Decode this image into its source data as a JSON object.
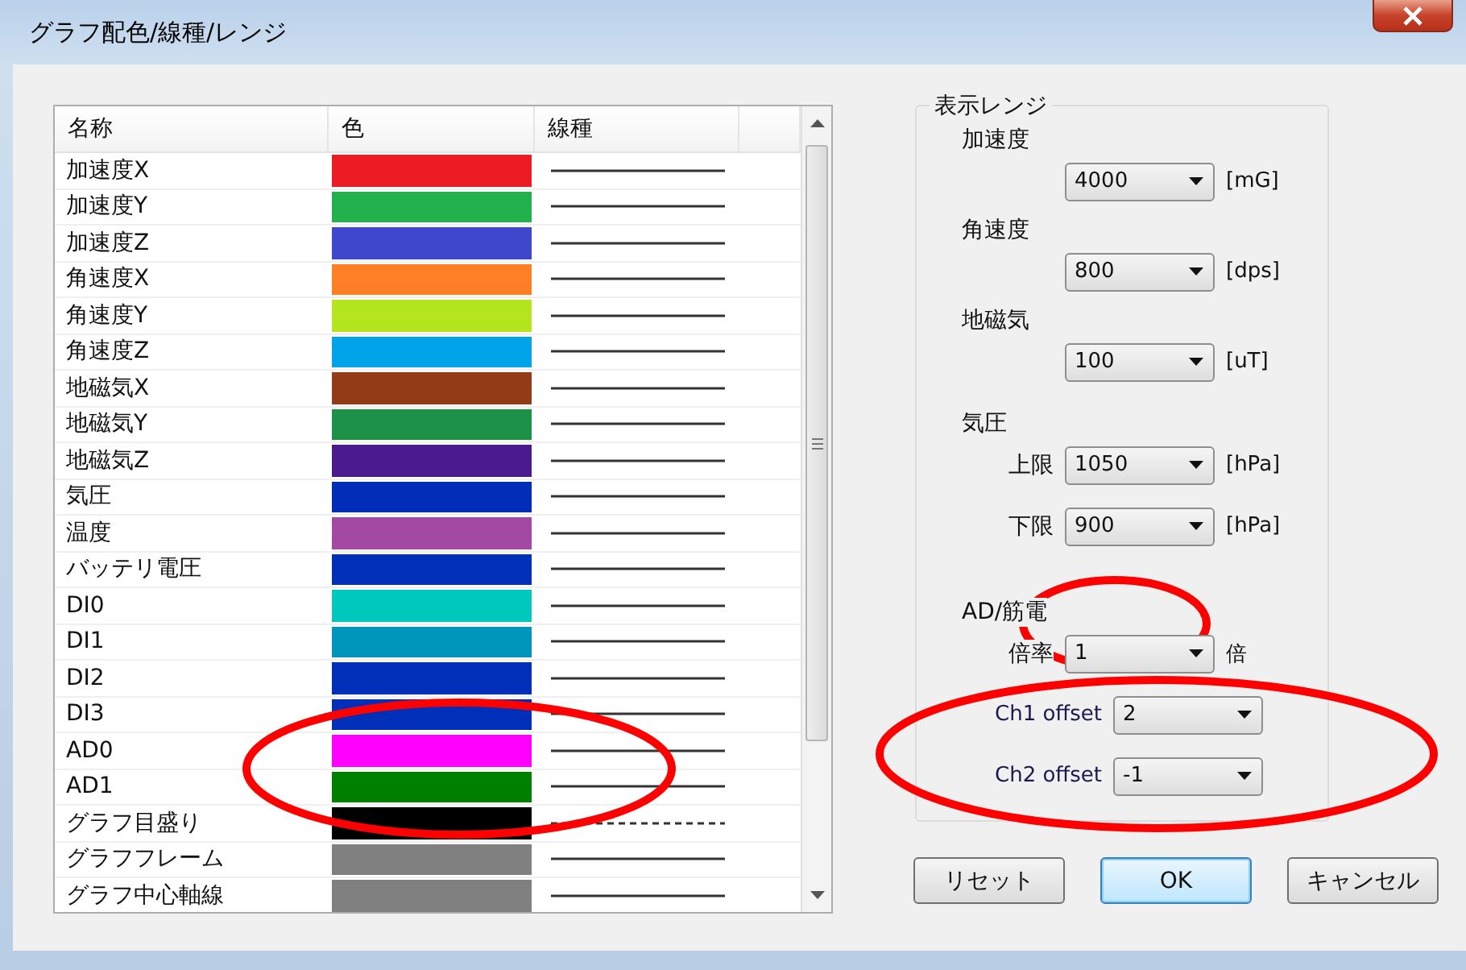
{
  "window": {
    "title": "グラフ配色/線種/レンジ"
  },
  "table": {
    "columns": [
      "名称",
      "色",
      "線種"
    ],
    "rows": [
      {
        "name": "加速度X",
        "color": "#ed1c24",
        "dashed": false
      },
      {
        "name": "加速度Y",
        "color": "#22b14c",
        "dashed": false
      },
      {
        "name": "加速度Z",
        "color": "#3f48cc",
        "dashed": false
      },
      {
        "name": "角速度X",
        "color": "#ff7f27",
        "dashed": false
      },
      {
        "name": "角速度Y",
        "color": "#b5e61d",
        "dashed": false
      },
      {
        "name": "角速度Z",
        "color": "#00a2e8",
        "dashed": false
      },
      {
        "name": "地磁気X",
        "color": "#933a16",
        "dashed": false
      },
      {
        "name": "地磁気Y",
        "color": "#1e9148",
        "dashed": false
      },
      {
        "name": "地磁気Z",
        "color": "#4b1a8e",
        "dashed": false
      },
      {
        "name": "気圧",
        "color": "#002eb8",
        "dashed": false
      },
      {
        "name": "温度",
        "color": "#a349a4",
        "dashed": false
      },
      {
        "name": "バッテリ電圧",
        "color": "#0030b8",
        "dashed": false
      },
      {
        "name": "DI0",
        "color": "#00c8bc",
        "dashed": false
      },
      {
        "name": "DI1",
        "color": "#0095ba",
        "dashed": false
      },
      {
        "name": "DI2",
        "color": "#0030b9",
        "dashed": false
      },
      {
        "name": "DI3",
        "color": "#0030ba",
        "dashed": false
      },
      {
        "name": "AD0",
        "color": "#ff00ff",
        "dashed": false
      },
      {
        "name": "AD1",
        "color": "#008000",
        "dashed": false
      },
      {
        "name": "グラフ目盛り",
        "color": "#000000",
        "dashed": true
      },
      {
        "name": "グラフフレーム",
        "color": "#808080",
        "dashed": false
      },
      {
        "name": "グラフ中心軸線",
        "color": "#808081",
        "dashed": false
      }
    ]
  },
  "range_group": {
    "title": "表示レンジ",
    "sections": [
      {
        "label": "加速度",
        "fields": [
          {
            "value": "4000",
            "unit": "[mG]"
          }
        ]
      },
      {
        "label": "角速度",
        "fields": [
          {
            "value": "800",
            "unit": "[dps]"
          }
        ]
      },
      {
        "label": "地磁気",
        "fields": [
          {
            "value": "100",
            "unit": "[uT]"
          }
        ]
      },
      {
        "label": "気圧",
        "fields": [
          {
            "label": "上限",
            "value": "1050",
            "unit": "[hPa]"
          },
          {
            "label": "下限",
            "value": "900",
            "unit": "[hPa]"
          }
        ]
      },
      {
        "label": "AD/筋電",
        "fields": [
          {
            "label": "倍率",
            "value": "1",
            "unit": "倍"
          },
          {
            "label": "Ch1 offset",
            "value": "2"
          },
          {
            "label": "Ch2 offset",
            "value": "-1"
          }
        ]
      }
    ]
  },
  "buttons": [
    {
      "label": "リセット",
      "default": false
    },
    {
      "label": "OK",
      "default": true
    },
    {
      "label": "キャンセル",
      "default": false
    }
  ],
  "annotations": [
    {
      "kind": "ellipse"
    },
    {
      "kind": "ellipse"
    },
    {
      "kind": "ellipse"
    }
  ]
}
